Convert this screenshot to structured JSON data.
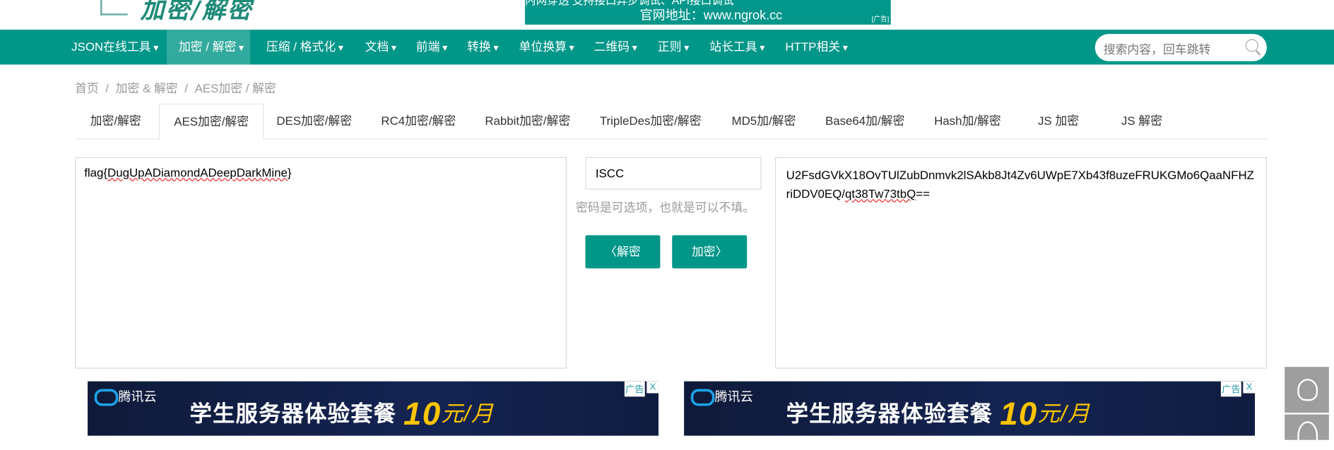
{
  "header": {
    "logo_text": "加密/解密",
    "ad": {
      "line1": "内网穿透  支持接口异步调试、API接口调试",
      "line2": "官网地址：www.ngrok.cc",
      "tag": "[广告]"
    }
  },
  "nav": {
    "items": [
      {
        "label": "JSON在线工具"
      },
      {
        "label": "加密 / 解密",
        "active": true
      },
      {
        "label": "压缩 / 格式化"
      },
      {
        "label": "文档"
      },
      {
        "label": "前端"
      },
      {
        "label": "转换"
      },
      {
        "label": "单位换算"
      },
      {
        "label": "二维码"
      },
      {
        "label": "正则"
      },
      {
        "label": "站长工具"
      },
      {
        "label": "HTTP相关"
      }
    ],
    "caret": "▼",
    "search_placeholder": "搜索内容，回车跳转"
  },
  "breadcrumb": [
    "首页",
    "加密 & 解密",
    "AES加密 / 解密"
  ],
  "breadcrumb_sep": "/",
  "tabs": [
    "加密/解密",
    "AES加密/解密",
    "DES加密/解密",
    "RC4加密/解密",
    "Rabbit加密/解密",
    "TripleDes加密/解密",
    "MD5加/解密",
    "Base64加/解密",
    "Hash加/解密",
    "JS 加密",
    "JS 解密"
  ],
  "active_tab": 1,
  "left_text": {
    "prefix": "flag{",
    "squiggle": "DugUpADiamondADeepDarkMine",
    "suffix": "}"
  },
  "password": "ISCC",
  "password_hint": "密码是可选项，也就是可以不填。",
  "buttons": {
    "decrypt": "解密",
    "encrypt": "加密",
    "left_arrow": "〈",
    "right_arrow": "〉"
  },
  "right_text": {
    "prefix": "U2FsdGVkX18OvTUlZubDnmvk2lSAkb8Jt4Zv6UWpE7Xb43f8uzeFRUKGMo6QaaNFHZriDDV0EQ/",
    "squiggle": "qt38Tw73tbQ",
    "suffix": "=="
  },
  "ads": [
    {
      "brand": "腾讯云",
      "text": "学生服务器体验套餐",
      "price": "10",
      "unit": "元/月",
      "tag": "广告",
      "close": "X"
    },
    {
      "brand": "腾讯云",
      "text": "学生服务器体验套餐",
      "price": "10",
      "unit": "元/月",
      "tag": "广告",
      "close": "X"
    }
  ],
  "colors": {
    "primary": "#009688",
    "active_nav": "#33aa9e"
  }
}
